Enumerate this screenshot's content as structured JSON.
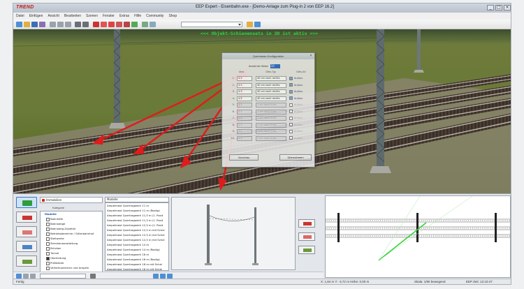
{
  "window": {
    "logo": "TREND",
    "title": "EEP Expert - Eisenbahn.exe - [Demo-Anlage zum Plug-in 2 von EEP 16.2]",
    "buttons": [
      "_",
      "□",
      "×"
    ]
  },
  "menu": {
    "items": [
      "Datei",
      "Einfügen",
      "Ansicht",
      "Bearbeiten",
      "Szenen",
      "Fenster",
      "Extras",
      "Hilfe",
      "Community",
      "Shop"
    ]
  },
  "viewport": {
    "overlay_text": "<<< Objekt-Schienensets in 3D ist aktiv >>>",
    "overlay_color": "#2bd24a",
    "arrow_color": "#e01b1b"
  },
  "dialog": {
    "title": "Quertrasse-Konfiguration",
    "count_label": "Anzahl der Gleise:",
    "count_value": "10",
    "headers": {
      "distance": "Abst.",
      "type": "Gleis-Typ",
      "status": "Gleis-Art"
    },
    "rows": [
      {
        "index": "1.",
        "distance": "4.5",
        "type": "40 cm nach rechts",
        "checked": true,
        "status": "An/Aus",
        "enabled": true
      },
      {
        "index": "2.",
        "distance": "4.5",
        "type": "40 cm nach rechts",
        "checked": true,
        "status": "An/Aus",
        "enabled": true
      },
      {
        "index": "3.",
        "distance": "4.5",
        "type": "40 cm nach rechts",
        "checked": true,
        "status": "An/Aus",
        "enabled": true
      },
      {
        "index": "4.",
        "distance": "4.5",
        "type": "40 cm nach rechts",
        "checked": true,
        "status": "An/Aus",
        "enabled": true
      },
      {
        "index": "5.",
        "distance": "4.5",
        "type": "1 cm nach links",
        "checked": false,
        "status": "An/Aus",
        "enabled": false
      },
      {
        "index": "6.",
        "distance": "4.5",
        "type": "1 cm nach links",
        "checked": false,
        "status": "An/Aus",
        "enabled": false
      },
      {
        "index": "7.",
        "distance": "4.5",
        "type": "1 cm nach links",
        "checked": false,
        "status": "An/Aus",
        "enabled": false
      },
      {
        "index": "8.",
        "distance": "4.5",
        "type": "1 cm nach links",
        "checked": false,
        "status": "An/Aus",
        "enabled": false
      },
      {
        "index": "9.",
        "distance": "4.5",
        "type": "1 cm nach links",
        "checked": false,
        "status": "An/Aus",
        "enabled": false
      },
      {
        "index": "10.",
        "distance": "4.5",
        "type": "1 cm nach links",
        "checked": false,
        "status": "An/Aus",
        "enabled": false
      }
    ],
    "preview_button": "Vorschau",
    "apply_button": "Übernehmen"
  },
  "bottom": {
    "category_combo": "Immobilien",
    "category_header": "Kategorie",
    "categories": [
      {
        "label": "Modelle",
        "kind": "root"
      },
      {
        "label": "Bahnhöfe",
        "kind": "box"
      },
      {
        "label": "Bahnsteige",
        "kind": "box"
      },
      {
        "label": "Bahnsteig-Zubehör",
        "kind": "box"
      },
      {
        "label": "Betriebsbereiche / Güterbahnhof",
        "kind": "box"
      },
      {
        "label": "Stellwerke",
        "kind": "box"
      },
      {
        "label": "Streckenausstattung",
        "kind": "box"
      },
      {
        "label": "Brücken",
        "kind": "box"
      },
      {
        "label": "Tunnel",
        "kind": "box"
      },
      {
        "label": "Oberleitung",
        "kind": "filled"
      },
      {
        "label": "Prellböcke",
        "kind": "box"
      },
      {
        "label": "Verkehrszeichen und Ampeln",
        "kind": "box"
      },
      {
        "label": "Signaltafeln",
        "kind": "box"
      },
      {
        "label": "LKW",
        "kind": "box"
      }
    ],
    "models_header": "Modelle",
    "models": [
      "Ampelmast Quertragwerk 11 m",
      "Ampelmast Quertragwerk 11 m (Rostig)",
      "Ampelmast Quertragwerk 11,5 m (1. Posit",
      "Ampelmast Quertragwerk 11,5 m (1. Posit",
      "Ampelmast Quertragwerk 12,5 m (1. Posit",
      "Ampelmast Quertragwerk 12,5 m mit Schei",
      "Ampelmast Quertragwerk 12,5 m mit Schei",
      "Ampelmast Quertragwerk 12,5 m mit Schei",
      "Ampelmast Quertragwerk 14 m",
      "Ampelmast Quertragwerk 14 m (Rostig)",
      "Ampelmast Quertragwerk 16 m",
      "Ampelmast Quertragwerk 16 m (Rostig)",
      "Ampelmast Quertragwerk 16 m mit Schei",
      "Ampelmast Quertragwerk 16 m mit Schei",
      "Ampelmast Quertragwerk 18 m",
      "Ampelmast Quertragwerk 18 m (Rostig)"
    ]
  },
  "status": {
    "left": "Fertig",
    "coords": "X: 1,84 m   Y: -3,72 m   Höhe: 0,00 m",
    "scale": "Skala: 1/90 bewegend",
    "time": "EEP Zeit: 12:10:47"
  },
  "colors": {
    "rail_green": "#36d237",
    "arrow_red": "#e01b1b"
  }
}
